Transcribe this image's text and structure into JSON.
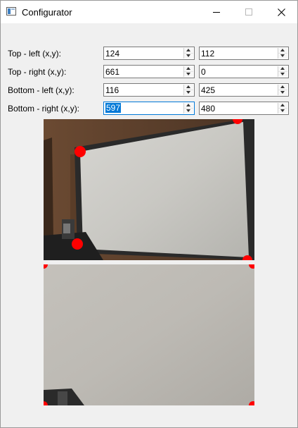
{
  "window": {
    "title": "Configurator",
    "icon": "app-window-icon",
    "controls": [
      "minimize-icon",
      "maximize-icon",
      "close-icon"
    ]
  },
  "fields": [
    {
      "label": "Top - left (x,y):",
      "x": "124",
      "y": "112"
    },
    {
      "label": "Top - right (x,y):",
      "x": "661",
      "y": "0"
    },
    {
      "label": "Bottom - left (x,y):",
      "x": "116",
      "y": "425"
    },
    {
      "label": "Bottom - right (x,y):",
      "x": "597",
      "y": "480"
    }
  ],
  "selection_color": "#0078d7",
  "marker_color": "#ff0000"
}
